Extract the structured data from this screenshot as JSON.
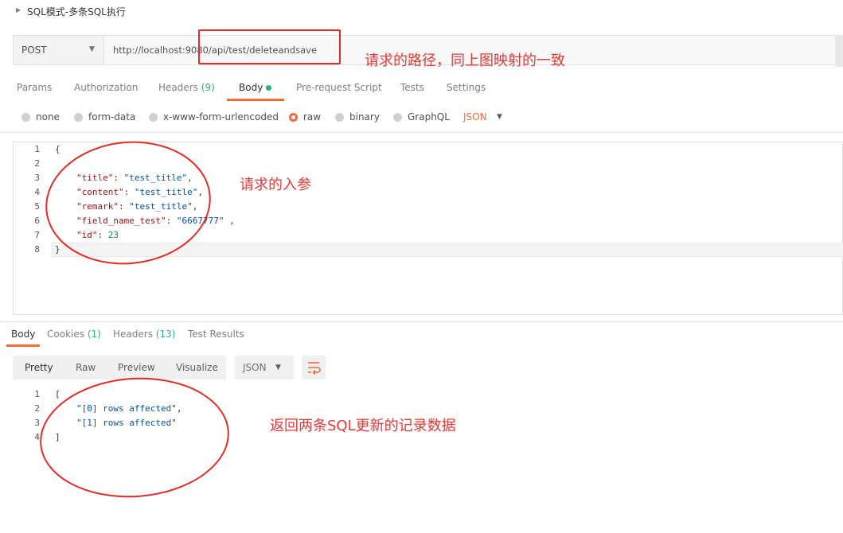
{
  "collection": {
    "title": "SQL模式-多条SQL执行"
  },
  "request": {
    "method": "POST",
    "url": "http://localhost:9080/api/test/deleteandsave"
  },
  "request_tabs": {
    "params": "Params",
    "authorization": "Authorization",
    "headers": "Headers",
    "headers_count": "(9)",
    "body": "Body",
    "pre_request": "Pre-request Script",
    "tests": "Tests",
    "settings": "Settings"
  },
  "body_types": {
    "none": "none",
    "form_data": "form-data",
    "urlencoded": "x-www-form-urlencoded",
    "raw": "raw",
    "binary": "binary",
    "graphql": "GraphQL",
    "format": "JSON"
  },
  "request_body": {
    "line_numbers": [
      "1",
      "2",
      "3",
      "4",
      "5",
      "6",
      "7",
      "8"
    ],
    "open": "{",
    "close": "}",
    "fields": [
      {
        "key": "\"title\"",
        "value": "\"test_title\"",
        "trail": ","
      },
      {
        "key": "\"content\"",
        "value": "\"test_title\"",
        "trail": ","
      },
      {
        "key": "\"remark\"",
        "value": "\"test_title\"",
        "trail": ","
      },
      {
        "key": "\"field_name_test\"",
        "value": "\"6667777\"",
        "trail": " ,"
      },
      {
        "key": "\"id\"",
        "value": "23",
        "trail": ""
      }
    ]
  },
  "response_tabs": {
    "body": "Body",
    "cookies": "Cookies",
    "cookies_count": "(1)",
    "headers": "Headers",
    "headers_count": "(13)",
    "test_results": "Test Results"
  },
  "response_view": {
    "pretty": "Pretty",
    "raw": "Raw",
    "preview": "Preview",
    "visualize": "Visualize",
    "format": "JSON"
  },
  "response_body": {
    "line_numbers": [
      "1",
      "2",
      "3",
      "4"
    ],
    "open": "[",
    "close": "]",
    "items": [
      {
        "value": "\"[0] rows affected\"",
        "trail": ","
      },
      {
        "value": "\"[1] rows affected\"",
        "trail": ""
      }
    ]
  },
  "annotations": {
    "url_note": "请求的路径，同上图映射的一致",
    "params_note": "请求的入参",
    "response_note": "返回两条SQL更新的记录数据"
  },
  "colors": {
    "accent": "#f26b3a",
    "annotation_red": "#e32a24",
    "count_green": "#26b47f"
  }
}
